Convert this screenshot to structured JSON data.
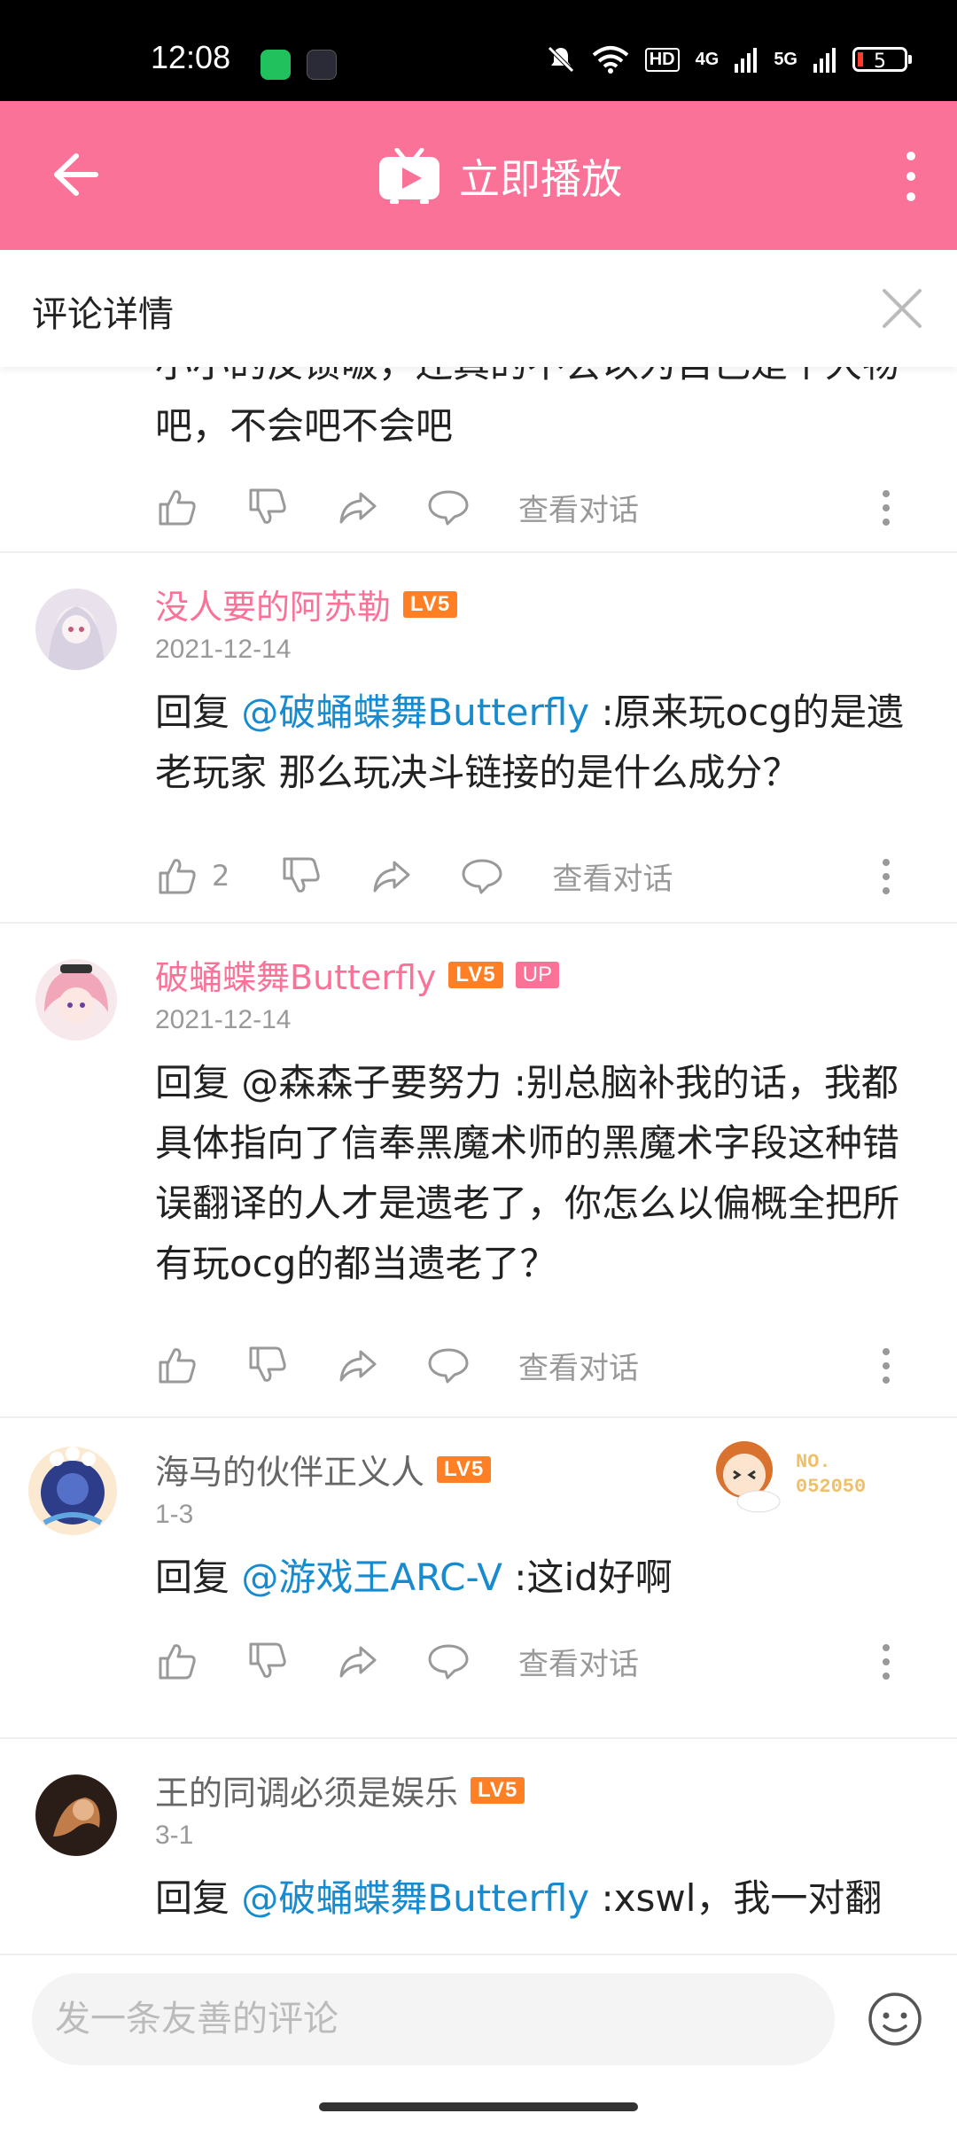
{
  "status_bar": {
    "time": "12:08",
    "battery": "5",
    "network_labels": [
      "HD",
      "4G",
      "5G"
    ],
    "icons": [
      "wechat-icon",
      "app-icon",
      "mute-icon",
      "wifi-icon",
      "signal-icon",
      "battery-icon"
    ]
  },
  "app_bar": {
    "title": "立即播放",
    "icons": [
      "back-arrow-icon",
      "tv-play-icon",
      "more-vertical-icon"
    ],
    "background": "#fb7299"
  },
  "detail_header": {
    "title": "评论详情"
  },
  "partial_comment": {
    "text": "小小的反馈啵，还真的不会以为自己是个大物吧，不会吧不会吧",
    "view_conversation": "查看对话"
  },
  "comments": [
    {
      "username": "没人要的阿苏勒",
      "level": "LV5",
      "date": "2021-12-14",
      "reply_prefix": "回复 ",
      "mention": "@破蛹蝶舞Butterfly",
      "text": " :原来玩ocg的是遗老玩家 那么玩决斗链接的是什么成分？",
      "likes": "2",
      "view_conversation": "查看对话"
    },
    {
      "username": "破蛹蝶舞Butterfly",
      "level": "LV5",
      "badge": "UP",
      "date": "2021-12-14",
      "text": "回复 @森森子要努力 :别总脑补我的话，我都具体指向了信奉黑魔术师的黑魔术字段这种错误翻译的人才是遗老了，你怎么以偏概全把所有玩ocg的都当遗老了？",
      "view_conversation": "查看对话"
    },
    {
      "username": "海马的伙伴正义人",
      "level": "LV5",
      "date": "1-3",
      "decoration_label": "NO.\n052050",
      "reply_prefix": "回复 ",
      "mention": "@游戏王ARC-V",
      "text": " :这id好啊",
      "view_conversation": "查看对话"
    },
    {
      "username": "王的同调必须是娱乐",
      "level": "LV5",
      "date": "3-1",
      "reply_prefix": "回复 ",
      "mention": "@破蛹蝶舞Butterfly",
      "text": " :xswl，我一对翻"
    }
  ],
  "bottom_bar": {
    "placeholder": "发一条友善的评论"
  },
  "colors": {
    "brand_pink": "#fb7299",
    "mention_blue": "#178bcf",
    "level_orange": "#ff7f24"
  }
}
